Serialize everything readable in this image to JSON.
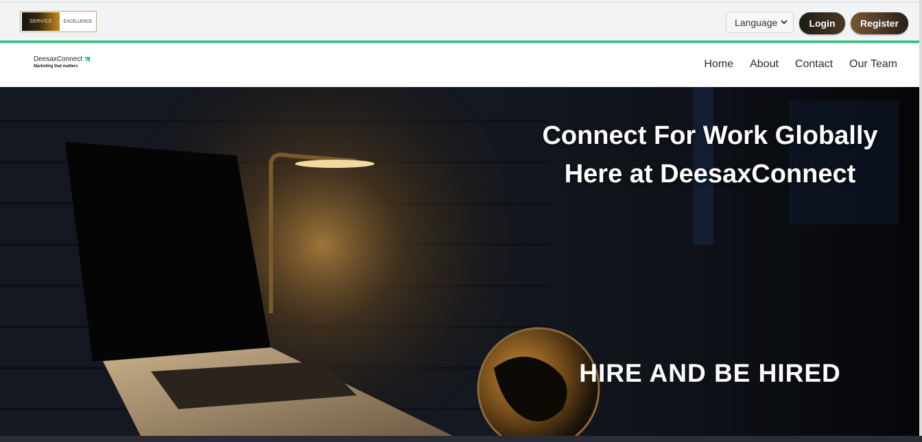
{
  "topbar": {
    "badge": {
      "left_text": "SERVICE",
      "right_text": "EXCELLENCE"
    },
    "language_select": {
      "value": "Language"
    },
    "login_label": "Login",
    "register_label": "Register"
  },
  "navbar": {
    "brand": {
      "name": "DeesaxConnect",
      "tagline": "Marketing that matters"
    },
    "links": [
      "Home",
      "About",
      "Contact",
      "Our Team"
    ]
  },
  "hero": {
    "title": "Connect For Work Globally Here at DeesaxConnect",
    "subtitle": "HIRE AND BE HIRED"
  },
  "colors": {
    "accent_line": "#3ec48a",
    "login_button": "#2e261c",
    "register_button": "#5e4330",
    "brand_mark": "#2bbf7a"
  },
  "icons": {
    "language_chevron": "chevron-down-icon",
    "brand_mark": "arrow-up-right-icon"
  }
}
